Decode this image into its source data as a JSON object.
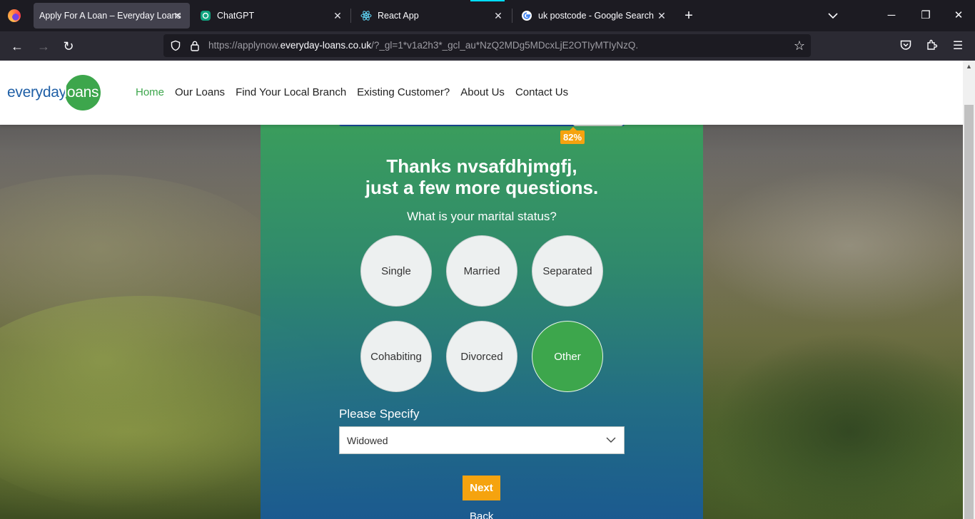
{
  "browser": {
    "tabs": [
      {
        "title": "Apply For A Loan – Everyday Loans",
        "icon": "everyday-loans-favicon",
        "active": true
      },
      {
        "title": "ChatGPT",
        "icon": "chatgpt-favicon",
        "active": false
      },
      {
        "title": "React App",
        "icon": "react-favicon",
        "active": false
      },
      {
        "title": "uk postcode - Google Search",
        "icon": "google-favicon",
        "active": false
      }
    ],
    "url_prefix": "https://applynow.",
    "url_domain": "everyday-loans.co.uk",
    "url_suffix": "/?_gl=1*v1a2h3*_gcl_au*NzQ2MDg5MDcxLjE2OTIyMTIyNzQ."
  },
  "site": {
    "logo_every": "everyday",
    "logo_loans": "loans",
    "nav": [
      "Home",
      "Our Loans",
      "Find Your Local Branch",
      "Existing Customer?",
      "About Us",
      "Contact Us"
    ],
    "nav_active": "Home"
  },
  "form": {
    "progress_label": "82%",
    "progress": 0.82,
    "heading_line1": "Thanks nvsafdhjmgfj,",
    "heading_line2": "just a few more questions.",
    "question": "What is your marital status?",
    "options": [
      "Single",
      "Married",
      "Separated",
      "Cohabiting",
      "Divorced",
      "Other"
    ],
    "selected_option": "Other",
    "specify_label": "Please Specify",
    "specify_value": "Widowed",
    "next_label": "Next",
    "back_label": "Back"
  },
  "colors": {
    "brand_green": "#3da64c",
    "brand_blue": "#1f5fa6",
    "accent_orange": "#f5a30f"
  }
}
